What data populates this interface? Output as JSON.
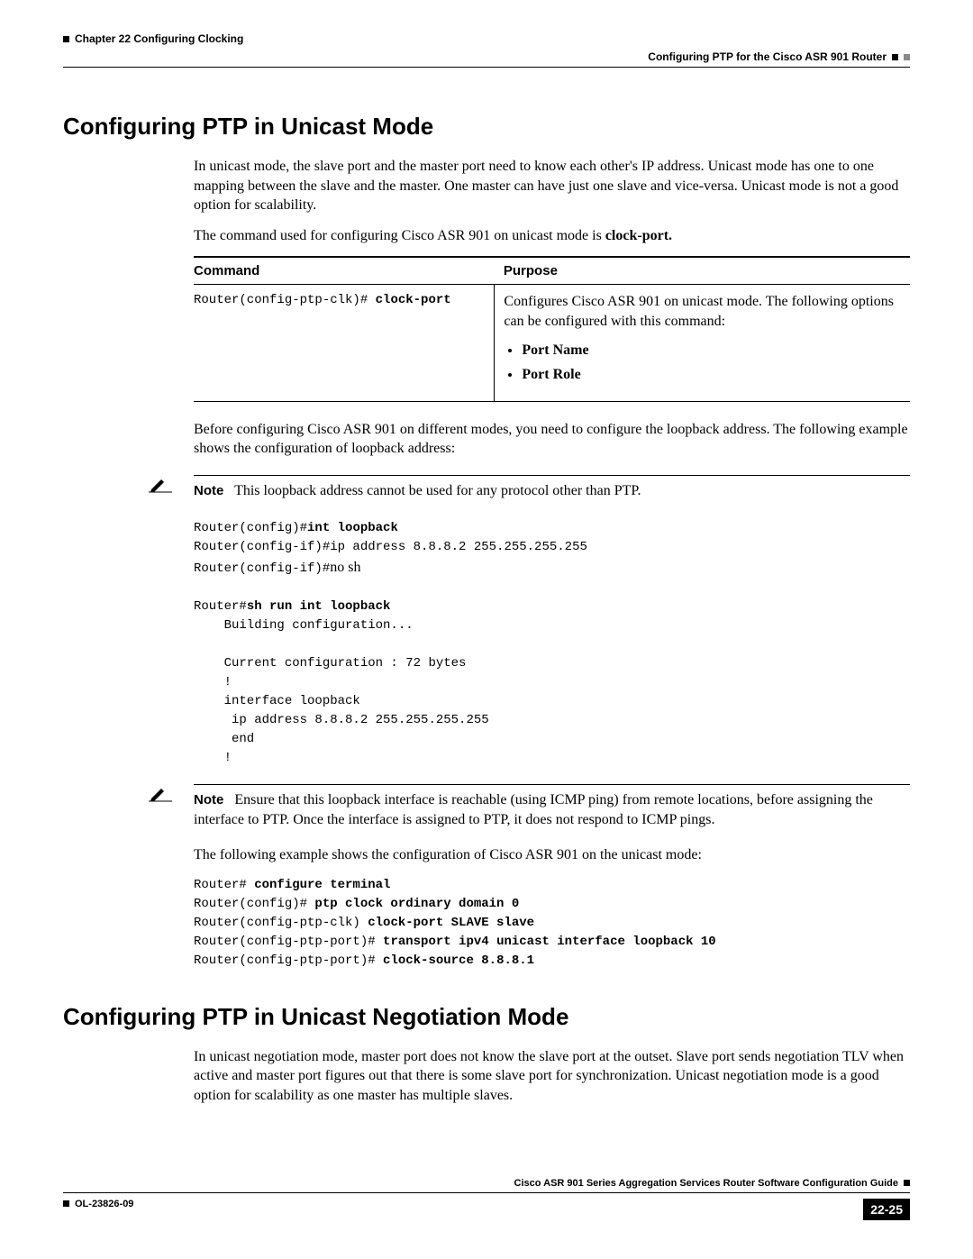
{
  "header": {
    "chapter": "Chapter 22    Configuring Clocking",
    "section": "Configuring PTP for the Cisco ASR 901 Router"
  },
  "section1": {
    "title": "Configuring PTP in Unicast Mode",
    "para1": "In unicast mode, the slave port and the master port need to know each other's IP address. Unicast mode has one to one mapping between the slave and the master. One master can have just one slave and vice-versa. Unicast mode is not a good option for scalability.",
    "para2_a": "The command used for configuring Cisco ASR 901 on unicast mode is ",
    "para2_b": "clock-port.",
    "table": {
      "h1": "Command",
      "h2": "Purpose",
      "cmd_prompt": "Router(config-ptp-clk)# ",
      "cmd_bold": "clock-port",
      "purpose": "Configures Cisco ASR 901 on unicast mode. The following options can be configured with this command:",
      "b1": "Port Name",
      "b2": "Port Role"
    },
    "para3": "Before configuring Cisco ASR 901 on different modes, you need to configure the loopback address. The following example shows the configuration of loopback address:",
    "note1_label": "Note",
    "note1_text": "This loopback address cannot be used for any protocol other than PTP.",
    "code1": {
      "l1a": "Router(config)#",
      "l1b": "int loopback",
      "l2": "Router(config-if)#ip address 8.8.8.2 255.255.255.255",
      "l3a": "Router(config-if)#",
      "l3b": "no sh",
      "l4a": "Router#",
      "l4b": "sh run int loopback",
      "l5": "    Building configuration...",
      "l6": "    Current configuration : 72 bytes",
      "l7": "    !",
      "l8": "    interface loopback",
      "l9": "     ip address 8.8.8.2 255.255.255.255",
      "l10": "     end",
      "l11": "    !"
    },
    "note2_label": "Note",
    "note2_text": "Ensure that this loopback interface is reachable (using ICMP ping) from remote locations, before assigning the interface to PTP. Once the interface is assigned to PTP, it does not respond to ICMP pings.",
    "para4": "The following example shows the configuration of Cisco ASR 901 on the unicast mode:",
    "code2": {
      "l1a": "Router# ",
      "l1b": "configure terminal",
      "l2a": "Router(config)# ",
      "l2b": "ptp clock ordinary domain 0",
      "l3a": "Router(config-ptp-clk) ",
      "l3b": "clock-port SLAVE slave",
      "l4a": "Router(config-ptp-port)# ",
      "l4b": "transport ipv4 unicast interface loopback 10",
      "l5a": "Router(config-ptp-port)# ",
      "l5b": "clock-source 8.8.8.1"
    }
  },
  "section2": {
    "title": "Configuring PTP in Unicast Negotiation Mode",
    "para1": "In unicast negotiation mode, master port does not know the slave port at the outset. Slave port sends negotiation TLV when active and master port figures out that there is some slave port for synchronization. Unicast negotiation mode is a good option for scalability as one master has multiple slaves."
  },
  "footer": {
    "guide": "Cisco ASR 901 Series Aggregation Services Router Software Configuration Guide",
    "docid": "OL-23826-09",
    "pagenum": "22-25"
  }
}
